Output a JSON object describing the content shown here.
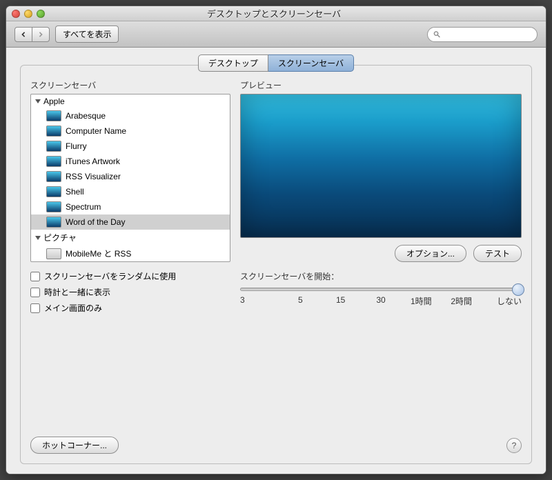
{
  "window": {
    "title": "デスクトップとスクリーンセーバ"
  },
  "toolbar": {
    "show_all": "すべてを表示"
  },
  "search": {
    "placeholder": ""
  },
  "tabs": {
    "desktop": "デスクトップ",
    "screensaver": "スクリーンセーバ"
  },
  "left": {
    "label": "スクリーンセーバ",
    "groups": {
      "apple": {
        "name": "Apple",
        "items": [
          "Arabesque",
          "Computer Name",
          "Flurry",
          "iTunes Artwork",
          "RSS Visualizer",
          "Shell",
          "Spectrum",
          "Word of the Day"
        ]
      },
      "pictures": {
        "name": "ピクチャ",
        "items": [
          "MobileMe と RSS"
        ]
      }
    },
    "selected": "Word of the Day"
  },
  "right": {
    "preview_label": "プレビュー",
    "options": "オプション...",
    "test": "テスト"
  },
  "checks": {
    "random": "スクリーンセーバをランダムに使用",
    "clock": "時計と一緒に表示",
    "main": "メイン画面のみ"
  },
  "slider": {
    "label": "スクリーンセーバを開始：",
    "ticks": [
      "3",
      "5",
      "15",
      "30",
      "1時間",
      "2時間",
      "しない"
    ]
  },
  "bottom": {
    "hotcorners": "ホットコーナー..."
  }
}
